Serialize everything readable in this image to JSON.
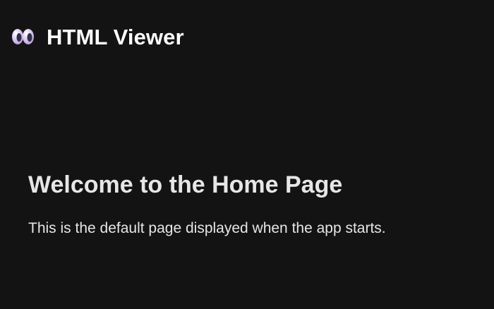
{
  "app": {
    "title": "HTML Viewer",
    "logo_icon": "eyes-icon"
  },
  "page": {
    "title": "Welcome to the Home Page",
    "description": "This is the default page displayed when the app starts."
  },
  "colors": {
    "background": "#131313",
    "title_text": "#ffffff",
    "body_text": "#e6e6e6"
  }
}
